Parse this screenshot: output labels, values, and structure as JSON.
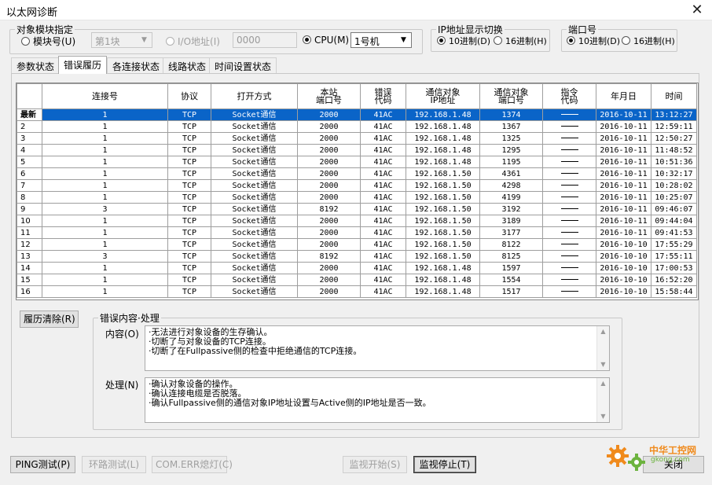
{
  "window": {
    "title": "以太网诊断",
    "close_glyph": "✕"
  },
  "target_group": {
    "title": "对象模块指定",
    "module_no_label": "模块号(U)",
    "module_combo_value": "第1块",
    "io_address_label": "I/O地址(I)",
    "io_address_value": "0000",
    "cpu_label": "CPU(M)",
    "cpu_combo_value": "1号机"
  },
  "ip_group": {
    "title": "IP地址显示切换",
    "dec_label": "10进制(D)",
    "hex_label": "16进制(H)"
  },
  "port_group": {
    "title": "端口号",
    "dec_label": "10进制(D)",
    "hex_label": "16进制(H)"
  },
  "tabs": [
    {
      "label": "参数状态"
    },
    {
      "label": "错误履历"
    },
    {
      "label": "各连接状态"
    },
    {
      "label": "线路状态"
    },
    {
      "label": "时间设置状态"
    }
  ],
  "table": {
    "columns": [
      {
        "key": "row",
        "label": ""
      },
      {
        "key": "conn",
        "label": "连接号"
      },
      {
        "key": "proto",
        "label": "协议"
      },
      {
        "key": "open",
        "label": "打开方式"
      },
      {
        "key": "local_port",
        "label": "本站\n端口号"
      },
      {
        "key": "err_code",
        "label": "错误\n代码"
      },
      {
        "key": "peer_ip",
        "label": "通信对象\nIP地址"
      },
      {
        "key": "peer_port",
        "label": "通信对象\n端口号"
      },
      {
        "key": "cmd_code",
        "label": "指令\n代码"
      },
      {
        "key": "date",
        "label": "年月日"
      },
      {
        "key": "time",
        "label": "时间"
      }
    ],
    "rows": [
      [
        "最新",
        "1",
        "TCP",
        "Socket通信",
        "2000",
        "41AC",
        "192.168.1.48",
        "1374",
        "—",
        "2016-10-11",
        "13:12:27"
      ],
      [
        "2",
        "1",
        "TCP",
        "Socket通信",
        "2000",
        "41AC",
        "192.168.1.48",
        "1367",
        "—",
        "2016-10-11",
        "12:59:11"
      ],
      [
        "3",
        "1",
        "TCP",
        "Socket通信",
        "2000",
        "41AC",
        "192.168.1.48",
        "1325",
        "—",
        "2016-10-11",
        "12:50:27"
      ],
      [
        "4",
        "1",
        "TCP",
        "Socket通信",
        "2000",
        "41AC",
        "192.168.1.48",
        "1295",
        "—",
        "2016-10-11",
        "11:48:52"
      ],
      [
        "5",
        "1",
        "TCP",
        "Socket通信",
        "2000",
        "41AC",
        "192.168.1.48",
        "1195",
        "—",
        "2016-10-11",
        "10:51:36"
      ],
      [
        "6",
        "1",
        "TCP",
        "Socket通信",
        "2000",
        "41AC",
        "192.168.1.50",
        "4361",
        "—",
        "2016-10-11",
        "10:32:17"
      ],
      [
        "7",
        "1",
        "TCP",
        "Socket通信",
        "2000",
        "41AC",
        "192.168.1.50",
        "4298",
        "—",
        "2016-10-11",
        "10:28:02"
      ],
      [
        "8",
        "1",
        "TCP",
        "Socket通信",
        "2000",
        "41AC",
        "192.168.1.50",
        "4199",
        "—",
        "2016-10-11",
        "10:25:07"
      ],
      [
        "9",
        "3",
        "TCP",
        "Socket通信",
        "8192",
        "41AC",
        "192.168.1.50",
        "3192",
        "—",
        "2016-10-11",
        "09:46:07"
      ],
      [
        "10",
        "1",
        "TCP",
        "Socket通信",
        "2000",
        "41AC",
        "192.168.1.50",
        "3189",
        "—",
        "2016-10-11",
        "09:44:04"
      ],
      [
        "11",
        "1",
        "TCP",
        "Socket通信",
        "2000",
        "41AC",
        "192.168.1.50",
        "3177",
        "—",
        "2016-10-11",
        "09:41:53"
      ],
      [
        "12",
        "1",
        "TCP",
        "Socket通信",
        "2000",
        "41AC",
        "192.168.1.50",
        "8122",
        "—",
        "2016-10-10",
        "17:55:29"
      ],
      [
        "13",
        "3",
        "TCP",
        "Socket通信",
        "8192",
        "41AC",
        "192.168.1.50",
        "8125",
        "—",
        "2016-10-10",
        "17:55:11"
      ],
      [
        "14",
        "1",
        "TCP",
        "Socket通信",
        "2000",
        "41AC",
        "192.168.1.48",
        "1597",
        "—",
        "2016-10-10",
        "17:00:53"
      ],
      [
        "15",
        "1",
        "TCP",
        "Socket通信",
        "2000",
        "41AC",
        "192.168.1.48",
        "1554",
        "—",
        "2016-10-10",
        "16:52:20"
      ],
      [
        "16",
        "1",
        "TCP",
        "Socket通信",
        "2000",
        "41AC",
        "192.168.1.48",
        "1517",
        "—",
        "2016-10-10",
        "15:58:44"
      ]
    ]
  },
  "history_clear_label": "履历清除(R)",
  "error_group": {
    "title": "错误内容·处理",
    "content_label": "内容(O)",
    "content_lines": [
      "·无法进行对象设备的生存确认。",
      "·切断了与对象设备的TCP连接。",
      "·切断了在Fullpassive侧的检查中拒绝通信的TCP连接。"
    ],
    "action_label": "处理(N)",
    "action_lines": [
      "·确认对象设备的操作。",
      "·确认连接电缆是否脱落。",
      "·确认Fullpassive侧的通信对象IP地址设置与Active侧的IP地址是否一致。"
    ]
  },
  "buttons": {
    "ping": "PING测试(P)",
    "loop": "环路测试(L)",
    "comerr": "COM.ERR熄灯(C)",
    "monitor_start": "监视开始(S)",
    "monitor_stop": "监视停止(T)",
    "close": "关闭"
  },
  "watermark": {
    "cn": "中华工控网",
    "url": "gkong.com"
  },
  "colors": {
    "selection": "#0a64c8",
    "watermark_orange": "#f08a1c",
    "watermark_green": "#6cb33e"
  }
}
